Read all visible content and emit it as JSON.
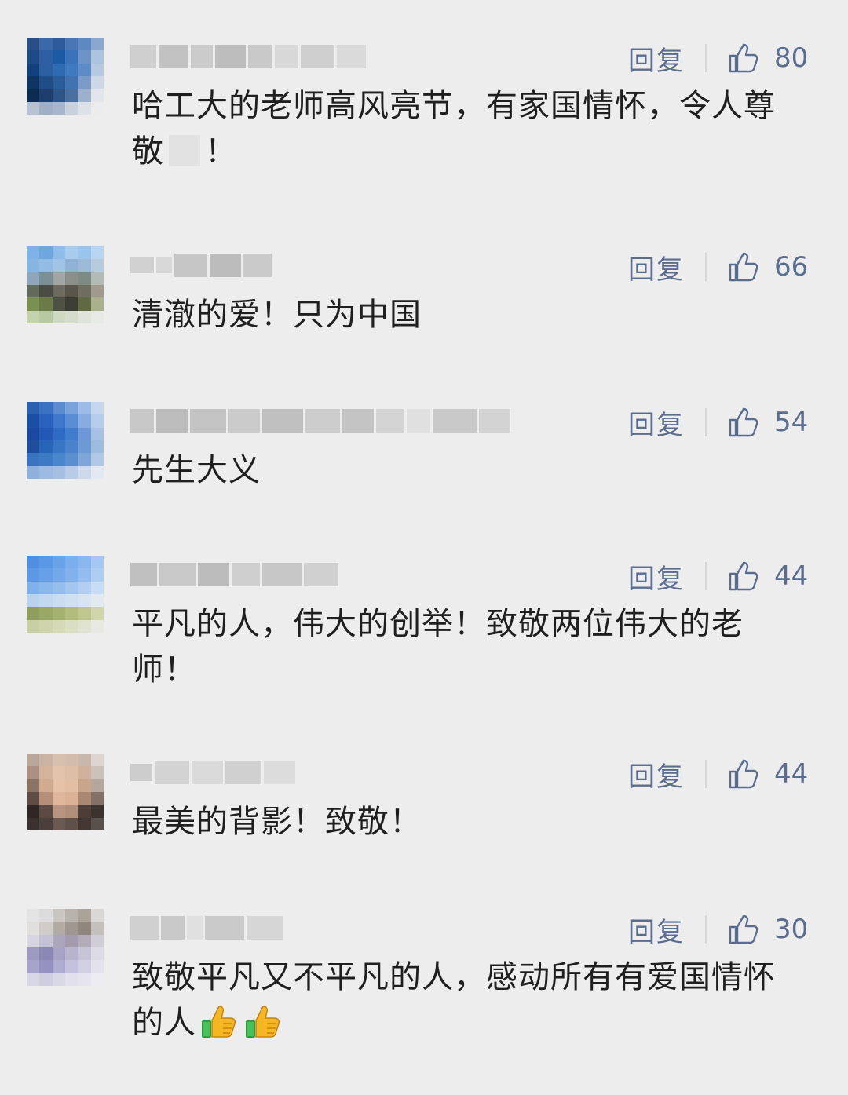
{
  "comments": [
    {
      "reply_label": "回复",
      "like_count": "80",
      "text_before": "哈工大的老师高风亮节，有家国情怀，令人尊敬",
      "text_after": "！",
      "avatar_colors": [
        "#2a4f86",
        "#3b69a8",
        "#2d5b9c",
        "#4a77b3",
        "#5d88c0",
        "#8aa7cf",
        "#1e4a85",
        "#2f5fa0",
        "#1c5aa6",
        "#3b73ba",
        "#6d93c6",
        "#aec3de",
        "#12417e",
        "#2b5f9f",
        "#2f6bb0",
        "#3f7ac0",
        "#5c8bc6",
        "#b7c9e0",
        "#0f3563",
        "#204d86",
        "#2c5d9b",
        "#4172b2",
        "#7b9bc6",
        "#cdd8e6",
        "#0d2c51",
        "#1e3f6c",
        "#2e5385",
        "#4b6f9f",
        "#9eb1cb",
        "#e2e6ec",
        "#b7c3d4",
        "#9fb0c6",
        "#a7b6ca",
        "#c8d1dc",
        "#dde2e8",
        "#ececec"
      ]
    },
    {
      "reply_label": "回复",
      "like_count": "66",
      "text": "清澈的爱！只为中国",
      "avatar_colors": [
        "#7fb2e6",
        "#6fa6df",
        "#8fbce9",
        "#a8cbee",
        "#9bc4ec",
        "#b8d5f1",
        "#86b5e2",
        "#93bce4",
        "#a0c3e6",
        "#8fb2d6",
        "#9dbad8",
        "#b7cbdf",
        "#8da6b9",
        "#7a8f97",
        "#a1a5a4",
        "#8b8f89",
        "#7e8a84",
        "#b3bbb7",
        "#616a5b",
        "#4b4c43",
        "#6c6a5f",
        "#595549",
        "#6f6c60",
        "#9f9a8c",
        "#7c8f52",
        "#6b7a47",
        "#4d5141",
        "#3c3d35",
        "#5f6a43",
        "#a9b08c",
        "#c5d3ad",
        "#b8c8a0",
        "#cfd8c0",
        "#d5dccb",
        "#dfe3d9",
        "#e8eae5"
      ]
    },
    {
      "reply_label": "回复",
      "like_count": "54",
      "text": "先生大义",
      "avatar_colors": [
        "#2b5fb0",
        "#3c72c2",
        "#5d8bd0",
        "#7aa2dc",
        "#9dbbe6",
        "#c5d6ee",
        "#1b4fa6",
        "#2a62bd",
        "#3f78cc",
        "#5b8dd6",
        "#88acdf",
        "#b8cdeb",
        "#1a49a0",
        "#2359b5",
        "#2e6bc4",
        "#417cce",
        "#6d97d6",
        "#a7c1e6",
        "#1e4f9c",
        "#2865b8",
        "#3776c4",
        "#4983cc",
        "#6e9ad3",
        "#9ebbe0",
        "#3a73c0",
        "#3d7ac4",
        "#4a86cc",
        "#5a90d0",
        "#7ea6d8",
        "#b1c8e6",
        "#8fb0dd",
        "#9cbae2",
        "#a5bfe3",
        "#b7cce8",
        "#cdd9ed",
        "#e3e9f2"
      ]
    },
    {
      "reply_label": "回复",
      "like_count": "44",
      "text": "平凡的人，伟大的创举！致敬两位伟大的老师！",
      "avatar_colors": [
        "#4f8ee0",
        "#5a97e4",
        "#6aa2e8",
        "#7cadec",
        "#8cb7ee",
        "#a6c7f1",
        "#5c98e3",
        "#67a0e6",
        "#73a8e9",
        "#82b2ec",
        "#93bdee",
        "#aecdf2",
        "#7fb0ea",
        "#8ab7ec",
        "#95beee",
        "#a3c6f0",
        "#b2cff2",
        "#c7dcf5",
        "#b9d2ed",
        "#c2d8ef",
        "#cadcef",
        "#d1e0f0",
        "#d8e4f1",
        "#e1eaf3",
        "#8f9e5c",
        "#9aa865",
        "#a5b26f",
        "#b2bc7d",
        "#c1c88f",
        "#d1d6aa",
        "#c9cfa4",
        "#cfd4ae",
        "#d5d9b8",
        "#dadec4",
        "#e0e3d0",
        "#e8e9e2"
      ]
    },
    {
      "reply_label": "回复",
      "like_count": "44",
      "text": "最美的背影！致敬！",
      "avatar_colors": [
        "#b9a79c",
        "#cbb4a5",
        "#d8c0ae",
        "#d2bcaa",
        "#c8b7ab",
        "#dcd5d0",
        "#a99081",
        "#d4b39c",
        "#e3c3ab",
        "#dfbea7",
        "#cfb19d",
        "#cbc1ba",
        "#8b7466",
        "#d0ab90",
        "#e6c2a8",
        "#e3bea3",
        "#c9a58c",
        "#b6a79c",
        "#5f4d45",
        "#b68f78",
        "#e0b79c",
        "#dcb297",
        "#a98771",
        "#847066",
        "#2f2724",
        "#5b4a43",
        "#b89580",
        "#b18e79",
        "#4c3d37",
        "#3c322e",
        "#3a3230",
        "#4a3f3b",
        "#6b5a52",
        "#5f504a",
        "#433834",
        "#5a504b"
      ]
    },
    {
      "reply_label": "回复",
      "like_count": "30",
      "text": "致敬平凡又不平凡的人，感动所有有爱国情怀的人",
      "avatar_colors": [
        "#e4e4e4",
        "#dcdcdc",
        "#c9c6c2",
        "#b8b3ad",
        "#a9a39a",
        "#d9d8d6",
        "#e0dfde",
        "#cfccc8",
        "#b2aba4",
        "#a09890",
        "#8f877e",
        "#c4c1bd",
        "#d7d6e0",
        "#c4c2d4",
        "#aba6bd",
        "#a29cae",
        "#b2adb8",
        "#cfced6",
        "#9d9cc0",
        "#8b89b4",
        "#a7a4c6",
        "#b8b4cd",
        "#c7c4d8",
        "#dcdbe6",
        "#a5a3c9",
        "#9493bf",
        "#b0aed0",
        "#c3c1db",
        "#d2d0e3",
        "#e2e1ec",
        "#d8d7e6",
        "#cfcee1",
        "#d9d8e7",
        "#e1e0ec",
        "#e6e5ef",
        "#ececf2"
      ]
    }
  ]
}
